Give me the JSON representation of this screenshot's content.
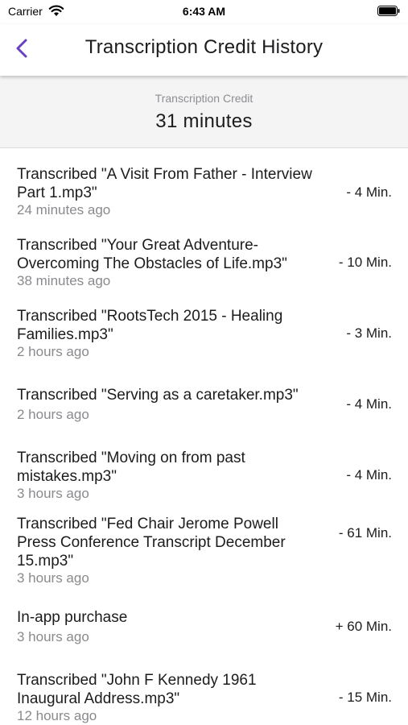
{
  "status_bar": {
    "carrier": "Carrier",
    "time": "6:43 AM",
    "icons": [
      "wifi-icon",
      "battery-icon"
    ]
  },
  "nav": {
    "title": "Transcription Credit History",
    "back_icon": "chevron-left-icon",
    "accent_color": "#6a3fc1"
  },
  "credit": {
    "label": "Transcription Credit",
    "value": "31 minutes"
  },
  "history": [
    {
      "title": "Transcribed \"A Visit From Father - Interview Part 1.mp3\"",
      "time": "24 minutes ago",
      "amount": "- 4 Min."
    },
    {
      "title": "Transcribed \"Your Great Adventure- Overcoming The Obstacles of Life.mp3\"",
      "time": "38 minutes ago",
      "amount": "- 10 Min."
    },
    {
      "title": "Transcribed \"RootsTech 2015 - Healing Families.mp3\"",
      "time": "2 hours ago",
      "amount": "- 3 Min."
    },
    {
      "title": "Transcribed \"Serving as a caretaker.mp3\"",
      "time": "2 hours ago",
      "amount": "- 4 Min."
    },
    {
      "title": "Transcribed \"Moving on from past mistakes.mp3\"",
      "time": "3 hours ago",
      "amount": "- 4 Min."
    },
    {
      "title": "Transcribed \"Fed Chair Jerome Powell Press Conference Transcript December 15.mp3\"",
      "time": "3 hours ago",
      "amount": "- 61 Min."
    },
    {
      "title": "In-app purchase",
      "time": "3 hours ago",
      "amount": "+ 60 Min."
    },
    {
      "title": "Transcribed \"John F Kennedy 1961 Inaugural Address.mp3\"",
      "time": "12 hours ago",
      "amount": "- 15 Min."
    }
  ]
}
